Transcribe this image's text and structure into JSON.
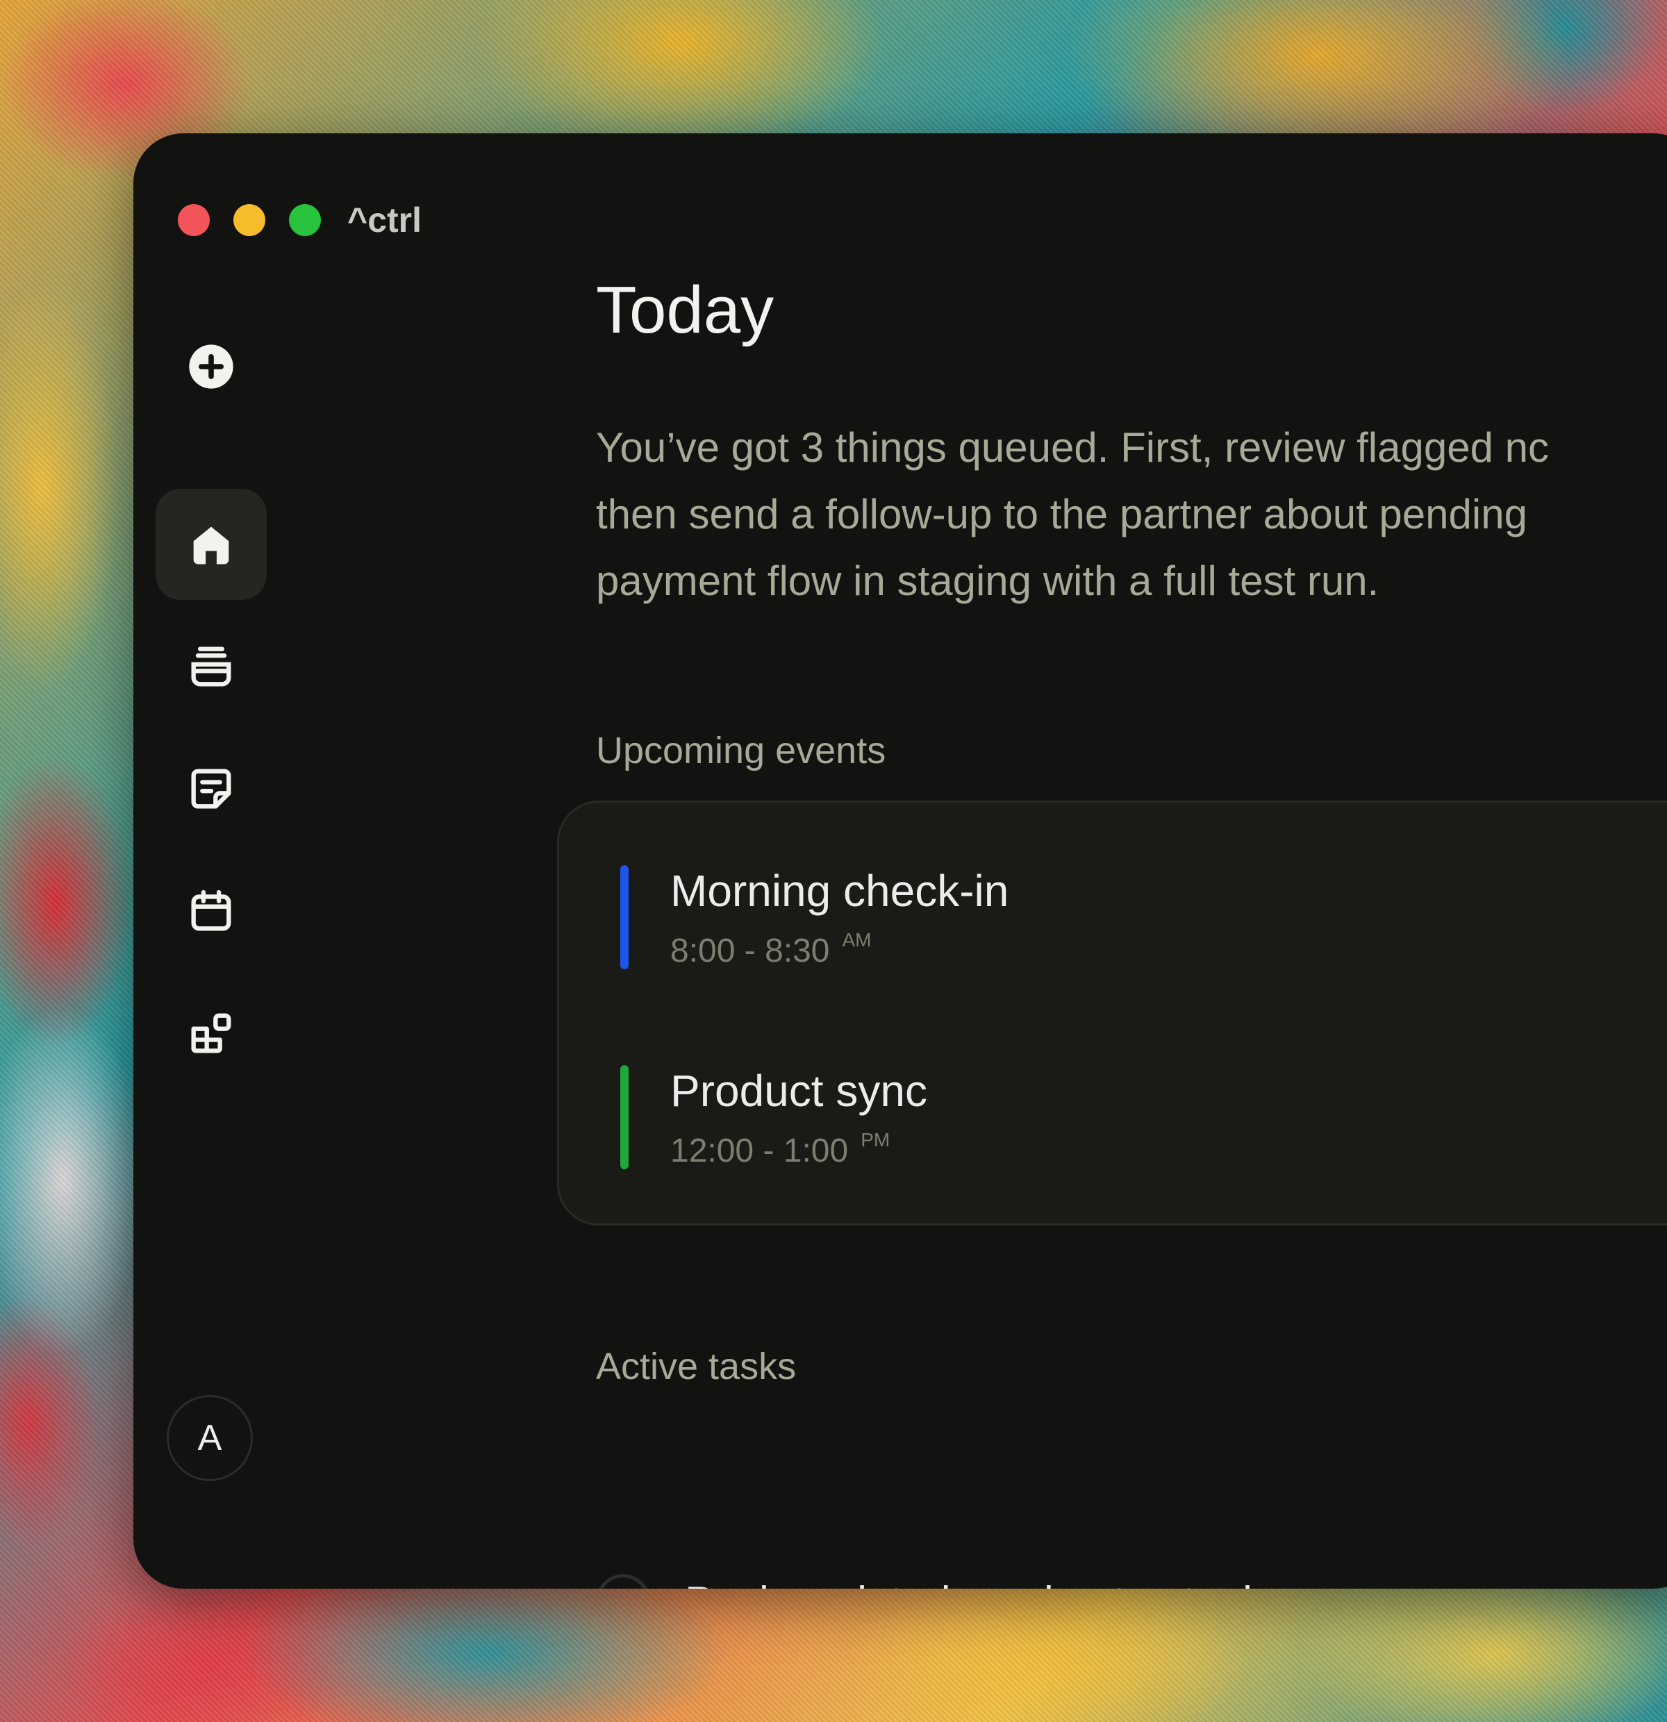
{
  "window": {
    "app_name": "^ctrl",
    "traffic_lights": {
      "close_color": "#f3545a",
      "minimize_color": "#f6bc2c",
      "zoom_color": "#27c33d"
    }
  },
  "sidebar": {
    "items": [
      {
        "name": "new",
        "icon": "plus-circle-icon"
      },
      {
        "name": "home",
        "icon": "home-icon",
        "active": true
      },
      {
        "name": "inbox",
        "icon": "stack-icon"
      },
      {
        "name": "notes",
        "icon": "note-icon"
      },
      {
        "name": "calendar",
        "icon": "calendar-icon"
      },
      {
        "name": "apps",
        "icon": "blocks-icon"
      }
    ],
    "avatar_initial": "A"
  },
  "main": {
    "title": "Today",
    "summary_lines": [
      "You’ve got 3 things queued. First, review flagged nc",
      "then send a follow-up to the partner about pending",
      "payment flow in staging with a full test run."
    ],
    "events_label": "Upcoming events",
    "events": [
      {
        "title": "Morning check-in",
        "time": "8:00 - 8:30",
        "period": "AM",
        "color": "#1f55e8"
      },
      {
        "title": "Product sync",
        "time": "12:00 - 1:00",
        "period": "PM",
        "color": "#1fa83c"
      }
    ],
    "tasks_label": "Active tasks",
    "tasks": [
      {
        "label": "Push updated version to staging",
        "done": false
      }
    ]
  }
}
